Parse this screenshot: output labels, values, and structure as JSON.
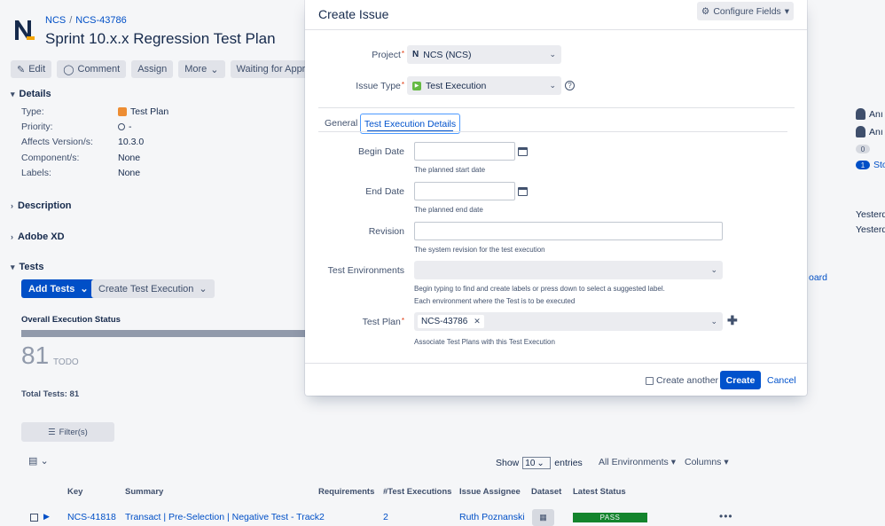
{
  "page": {
    "breadcrumb": {
      "project": "NCS",
      "sep": "/",
      "issue_key": "NCS-43786"
    },
    "title": "Sprint 10.x.x Regression Test Plan",
    "toolbar": {
      "edit": "Edit",
      "comment": "Comment",
      "assign": "Assign",
      "more": "More",
      "workflow": "Waiting for Approval"
    },
    "details": {
      "heading": "Details",
      "rows": [
        {
          "label": "Type:",
          "value": "Test Plan"
        },
        {
          "label": "Priority:",
          "value": "-"
        },
        {
          "label": "Affects Version/s:",
          "value": "10.3.0"
        },
        {
          "label": "Component/s:",
          "value": "None"
        },
        {
          "label": "Labels:",
          "value": "None"
        }
      ]
    },
    "sections": {
      "description": "Description",
      "adobe_xd": "Adobe XD",
      "tests": "Tests"
    },
    "tests": {
      "add_tests": "Add Tests",
      "create_execution": "Create Test Execution",
      "overall_status_label": "Overall Execution Status",
      "todo_count": "81",
      "todo_label": "TODO",
      "todo_fraction": 1.0,
      "total_label": "Total Tests: 81",
      "filter_label": "Filter(s)",
      "show_label": "Show",
      "show_value": "10",
      "entries_label": "entries",
      "environments_dd": "All Environments",
      "columns_dd": "Columns",
      "headers": {
        "key": "Key",
        "summary": "Summary",
        "requirements": "Requirements",
        "executions": "#Test Executions",
        "assignee": "Issue Assignee",
        "dataset": "Dataset",
        "status": "Latest Status"
      },
      "row": {
        "key": "NCS-41818",
        "summary": "Transact | Pre-Selection | Negative Test - Track2",
        "executions": "2",
        "assignee": "Ruth Poznanski",
        "status": "PASS"
      }
    },
    "right_panel": {
      "p1": "Anı",
      "p2": "Anı",
      "badge0": "0",
      "badge1": "1",
      "badge1_text": "Sto",
      "date1": "Yesterd",
      "date2": "Yesterd",
      "board": "oard"
    },
    "colors": {
      "primary": "#0052cc",
      "pass": "#14892c",
      "required": "#de350b"
    }
  },
  "modal": {
    "title": "Create Issue",
    "configure_fields": "Configure Fields",
    "project_label": "Project",
    "project_value": "NCS (NCS)",
    "issue_type_label": "Issue Type",
    "issue_type_value": "Test Execution",
    "tabs": {
      "general": "General",
      "details": "Test Execution Details"
    },
    "begin_date": {
      "label": "Begin Date",
      "value": "",
      "help": "The planned start date"
    },
    "end_date": {
      "label": "End Date",
      "value": "",
      "help": "The planned end date"
    },
    "revision": {
      "label": "Revision",
      "value": "",
      "help": "The system revision for the test execution"
    },
    "test_environments": {
      "label": "Test Environments",
      "help1": "Begin typing to find and create labels or press down to select a suggested label.",
      "help2": "Each environment where the Test is to be executed"
    },
    "test_plan": {
      "label": "Test Plan",
      "chip": "NCS-43786",
      "help": "Associate Test Plans with this Test Execution"
    },
    "footer": {
      "create_another": "Create another",
      "create": "Create",
      "cancel": "Cancel"
    }
  }
}
